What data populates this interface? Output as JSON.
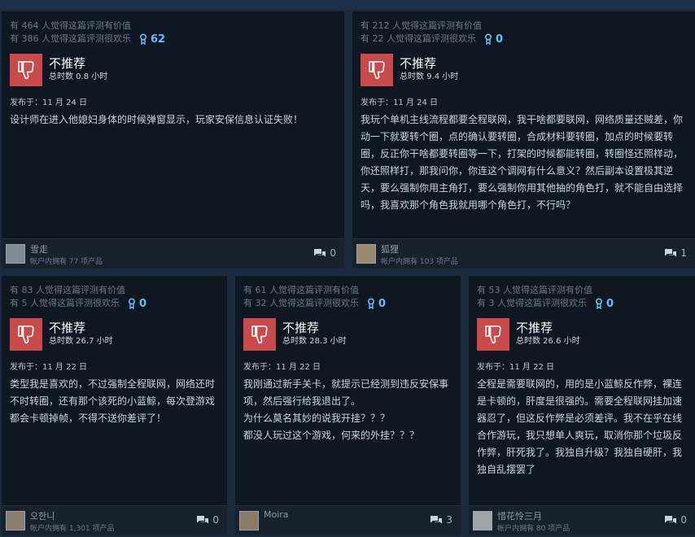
{
  "reviews": [
    {
      "helpful": "有 464 人觉得这篇评测有价值",
      "funny": "有 386 人觉得这篇评测很欢乐",
      "awards": "62",
      "recommendation": "不推荐",
      "hours": "总时数 0.8 小时",
      "posted": "发布于：11 月 24 日",
      "content": [
        "设计师在进入他媳妇身体的时候弹窗显示，玩家安保信息认证失败！"
      ],
      "user": "雪走",
      "owns": "帐户内拥有 77 项产品",
      "comments": "0"
    },
    {
      "helpful": "有 212 人觉得这篇评测有价值",
      "funny": "有 22 人觉得这篇评测很欢乐",
      "awards": "0",
      "recommendation": "不推荐",
      "hours": "总时数 9.4 小时",
      "posted": "发布于：11 月 24 日",
      "content": [
        "我玩个单机主线流程都要全程联网，我干啥都要联网，网络质量还贼差，你动一下就要转个圈，点的确认要转圈，合成材料要转圈，加点的时候要转圈，反正你干啥都要转圈等一下，打架的时候都能转圈，转圈怪还照样动，你还照样打，那我问你，你连这个调网有什么意义？然后副本设置极其逆天，要么强制你用主角打，要么强制你用其他抽的角色打，就不能自由选择吗，我喜欢那个角色我就用哪个角色打，不行吗？"
      ],
      "user": "狐狸",
      "owns": "帐户内拥有 103 项产品",
      "comments": "1"
    },
    {
      "helpful": "有 83 人觉得这篇评测有价值",
      "funny": "有 5 人觉得这篇评测很欢乐",
      "awards": "0",
      "recommendation": "不推荐",
      "hours": "总时数 26.7 小时",
      "posted": "发布于：11 月 22 日",
      "content": [
        "类型我是喜欢的，不过强制全程联网，网络还时不时转圈，还有那个该死的小蓝鲸，每次登游戏都会卡顿掉帧，不得不送你差评了！"
      ],
      "user": "오한니",
      "owns": "帐户内拥有 1,301 项产品",
      "comments": "0"
    },
    {
      "helpful": "有 61 人觉得这篇评测有价值",
      "funny": "有 32 人觉得这篇评测很欢乐",
      "awards": "0",
      "recommendation": "不推荐",
      "hours": "总时数 28.3 小时",
      "posted": "发布于：11 月 22 日",
      "content": [
        "我刚通过新手关卡，就提示已经测到违反安保事项，然后强行给我退出了。",
        "为什么莫名其妙的说我开挂？？？",
        "都没人玩过这个游戏，何来的外挂？？？"
      ],
      "user": "Moira",
      "owns": "",
      "comments": "3"
    },
    {
      "helpful": "有 53 人觉得这篇评测有价值",
      "funny": "有 3 人觉得这篇评测很欢乐",
      "awards": "0",
      "recommendation": "不推荐",
      "hours": "总时数 26.6 小时",
      "posted": "发布于：11 月 22 日",
      "content": [
        "全程是需要联网的，用的是小蓝鲸反作弊，裸连是卡顿的，肝度是很强的。需要全程联网挂加速器忍了，但这反作弊是必须差评。我不在乎在线合作游玩，我只想单人爽玩，取消你那个垃圾反作弊，肝死我了。我独自升级？我独自硬肝，我独自乱摆罢了"
      ],
      "user": "惜花怜三月",
      "owns": "帐户内拥有 80 项产品",
      "comments": "0"
    }
  ]
}
